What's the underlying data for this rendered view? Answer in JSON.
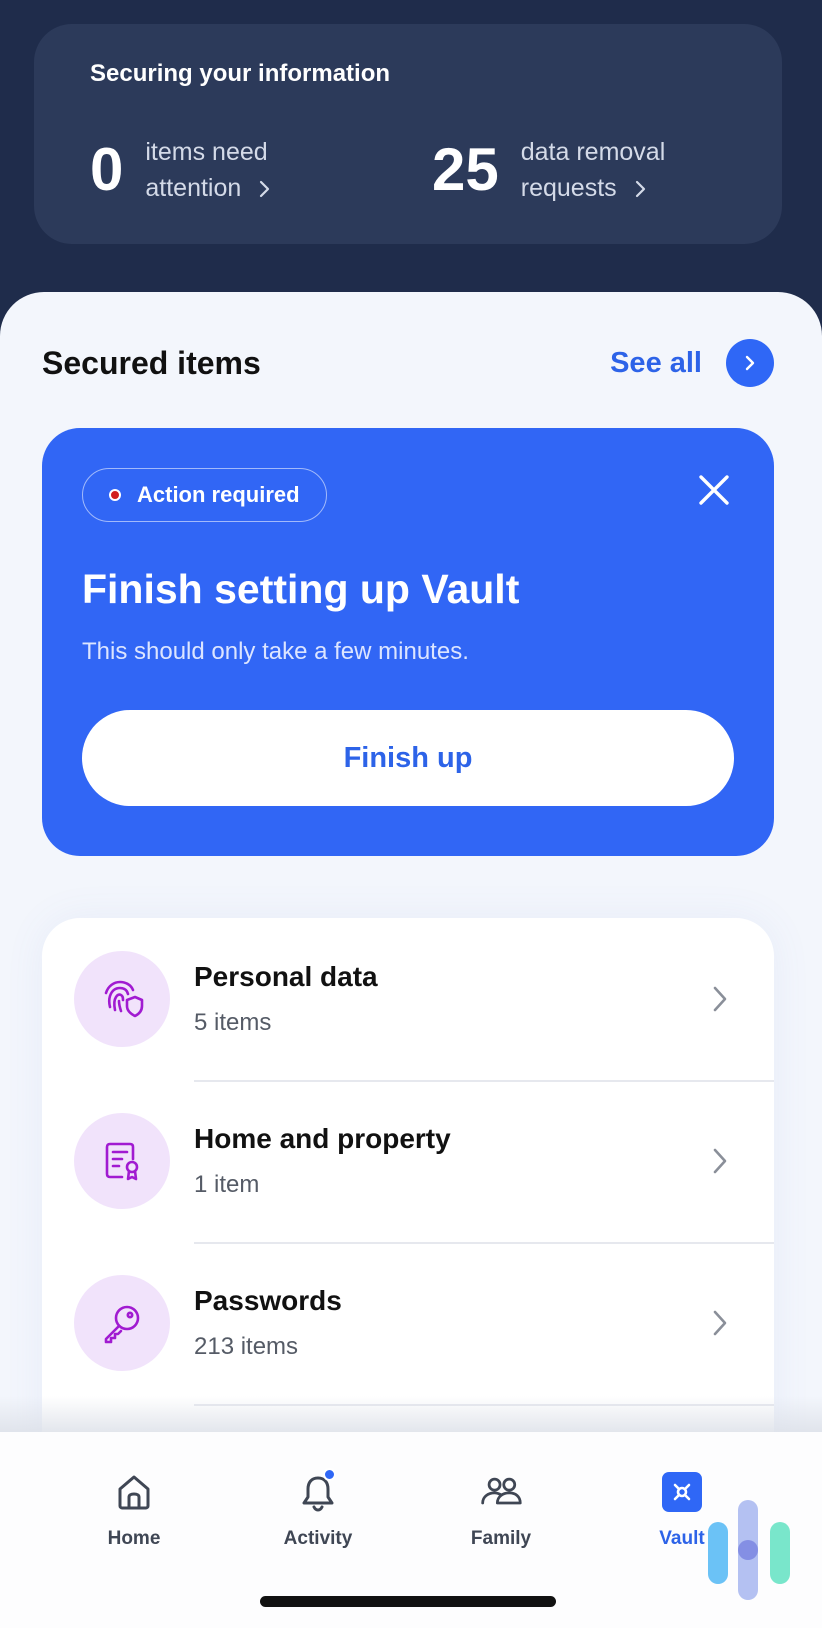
{
  "summary": {
    "title": "Securing your information",
    "attention_count": "0",
    "attention_line1": "items need",
    "attention_line2": "attention",
    "removal_count": "25",
    "removal_line1": "data removal",
    "removal_line2": "requests"
  },
  "secured": {
    "title": "Secured items",
    "see_all_label": "See all"
  },
  "action_card": {
    "badge_label": "Action required",
    "title": "Finish setting up Vault",
    "subtitle": "This should only take a few minutes.",
    "button_label": "Finish up"
  },
  "items": [
    {
      "title": "Personal data",
      "count": "5 items",
      "icon": "fingerprint-shield-icon"
    },
    {
      "title": "Home and property",
      "count": "1 item",
      "icon": "property-document-icon"
    },
    {
      "title": "Passwords",
      "count": "213 items",
      "icon": "key-icon"
    }
  ],
  "nav": [
    {
      "label": "Home",
      "icon": "home-icon"
    },
    {
      "label": "Activity",
      "icon": "bell-icon"
    },
    {
      "label": "Family",
      "icon": "family-icon"
    },
    {
      "label": "Vault",
      "icon": "vault-icon"
    }
  ],
  "colors": {
    "header_bg": "#1f2c4b",
    "accent": "#2f67f6",
    "icon_purple": "#a11bd1",
    "icon_circle": "#f1e3fb"
  }
}
